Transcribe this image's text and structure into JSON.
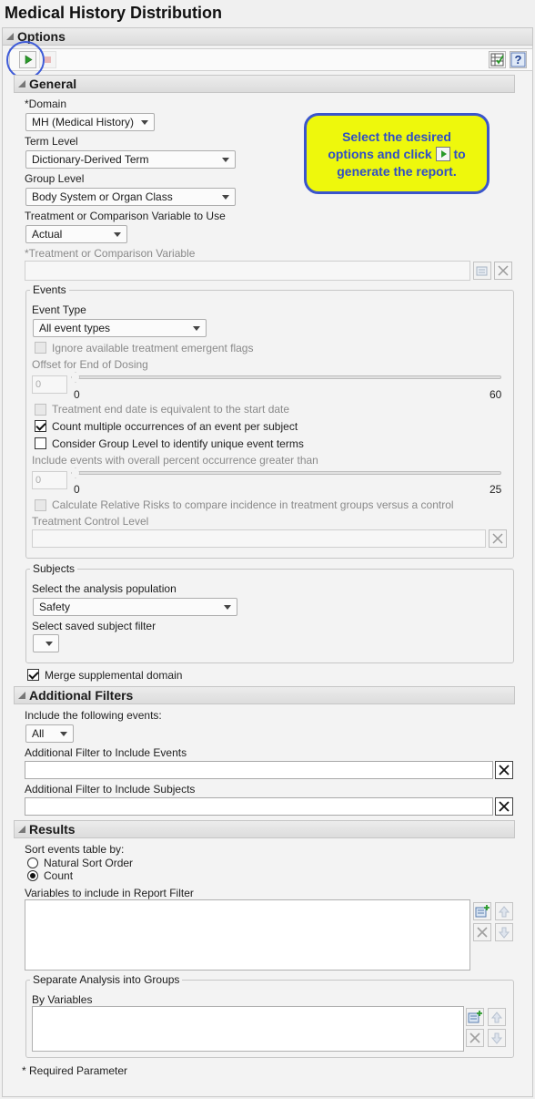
{
  "title": "Medical History Distribution",
  "options_header": "Options",
  "general": {
    "header": "General",
    "domain_label": "*Domain",
    "domain_value": "MH (Medical History)",
    "term_level_label": "Term Level",
    "term_level_value": "Dictionary-Derived Term",
    "group_level_label": "Group Level",
    "group_level_value": "Body System or Organ Class",
    "treatment_var_use_label": "Treatment or Comparison Variable to Use",
    "treatment_var_use_value": "Actual",
    "treatment_var_label": "*Treatment or Comparison Variable"
  },
  "callout": {
    "line1": "Select the desired",
    "line2a": "options and click",
    "line2b": "to",
    "line3": "generate the report."
  },
  "events": {
    "title": "Events",
    "event_type_label": "Event Type",
    "event_type_value": "All event types",
    "ignore_flags_label": "Ignore available treatment emergent flags",
    "offset_label": "Offset for End of Dosing",
    "offset_value": "0",
    "offset_min": "0",
    "offset_max": "60",
    "treat_end_label": "Treatment end date is equivalent to the start date",
    "count_multiple_label": "Count multiple occurrences of an event per subject",
    "consider_group_label": "Consider Group Level to identify unique event terms",
    "include_pct_label": "Include events with overall percent occurrence greater than",
    "pct_value": "0",
    "pct_min": "0",
    "pct_max": "25",
    "relative_risk_label": "Calculate Relative Risks to compare incidence in treatment groups versus a control",
    "control_level_label": "Treatment Control Level"
  },
  "subjects": {
    "title": "Subjects",
    "population_label": "Select the analysis population",
    "population_value": "Safety",
    "saved_filter_label": "Select saved subject filter"
  },
  "merge_label": "Merge supplemental domain",
  "additional_filters": {
    "header": "Additional Filters",
    "include_label": "Include the following events:",
    "include_value": "All",
    "filter_events_label": "Additional Filter to Include Events",
    "filter_subjects_label": "Additional Filter to Include Subjects"
  },
  "results": {
    "header": "Results",
    "sort_label": "Sort events table by:",
    "sort_natural": "Natural Sort Order",
    "sort_count": "Count",
    "report_filter_label": "Variables to include in Report Filter",
    "separate_title": "Separate Analysis into Groups",
    "by_variables_label": "By Variables"
  },
  "required_note": "* Required Parameter",
  "colors": {
    "callout_bg": "#eef80c",
    "callout_border": "#3a55cc",
    "callout_text": "#2f4ec7",
    "run_green": "#2a9a2a"
  },
  "icons": [
    "run-icon",
    "stop-icon",
    "spreadsheet-icon",
    "help-icon",
    "add-icon",
    "close-icon",
    "arrow-up-icon",
    "arrow-down-icon",
    "collapse-triangle-icon"
  ]
}
